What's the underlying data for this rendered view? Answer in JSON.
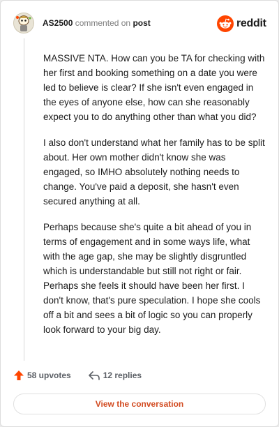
{
  "comment": {
    "username": "AS2500",
    "action": "commented on",
    "link": "post",
    "paragraphs": [
      "MASSIVE NTA. How can you be TA for checking with her first and booking something on a date you were led to believe is clear? If she isn't even engaged in the eyes of anyone else, how can she reasonably expect you to do anything other than what you did?",
      "I also don't understand what her family has to be split about. Her own mother didn't know she was engaged, so IMHO absolutely nothing needs to change. You've paid a deposit, she hasn't even secured anything at all.",
      "Perhaps because she's quite a bit ahead of you in terms of engagement and in some ways life, what with the age gap, she may be slightly disgruntled which is understandable but still not right or fair. Perhaps she feels it should have been her first. I don't know, that's pure speculation. I hope she cools off a bit and sees a bit of logic so you can properly look forward to your big day."
    ],
    "upvotes": "58 upvotes",
    "replies": "12 replies"
  },
  "brand": {
    "name": "reddit",
    "icon": "reddit-logo-icon",
    "color": "#ff4500"
  },
  "avatar": {
    "icon": "snoo-avatar-icon"
  },
  "actions": {
    "upvote_icon": "upvote-arrow-icon",
    "reply_icon": "reply-arrow-icon",
    "view_button": "View the conversation"
  },
  "colors": {
    "accent": "#ff4500",
    "link_button": "#d24b21",
    "muted": "#7c7c7c"
  }
}
